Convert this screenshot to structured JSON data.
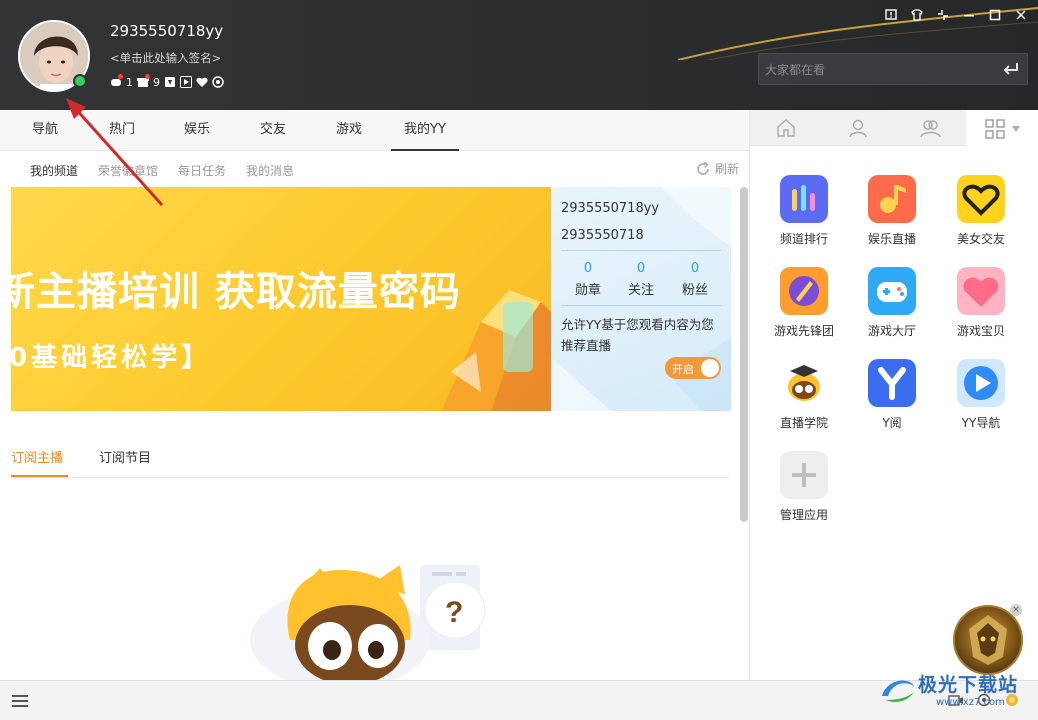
{
  "header": {
    "username": "2935550718yy",
    "signature": "<单击此处输入签名>",
    "status_counts": [
      "1",
      "9"
    ],
    "search_placeholder": "大家都在看"
  },
  "nav": {
    "tabs": [
      "导航",
      "热门",
      "娱乐",
      "交友",
      "游戏",
      "我的YY"
    ],
    "active_tab": "我的YY"
  },
  "subnav": {
    "items": [
      "我的频道",
      "荣誉徽章馆",
      "每日任务",
      "我的消息"
    ],
    "refresh_label": "刷新"
  },
  "banner": {
    "line1": "新主播培训 获取流量密码",
    "line2": "0基础轻松学】"
  },
  "profile_card": {
    "name": "2935550718yy",
    "id": "2935550718",
    "stats": [
      {
        "value": "0",
        "label": "勋章"
      },
      {
        "value": "0",
        "label": "关注"
      },
      {
        "value": "0",
        "label": "粉丝"
      }
    ],
    "note": "允许YY基于您观看内容为您推荐直播",
    "toggle_label": "开启",
    "toggle_on": true
  },
  "subscriptions": {
    "tabs": [
      "订阅主播",
      "订阅节目"
    ],
    "active": "订阅主播"
  },
  "apps": [
    {
      "label": "频道排行",
      "icon": "bar-chart-icon",
      "color": "#5b6cf2"
    },
    {
      "label": "娱乐直播",
      "icon": "music-note-icon",
      "color": "#ff6b4a"
    },
    {
      "label": "美女交友",
      "icon": "heart-icon",
      "color": "#ffd21e"
    },
    {
      "label": "游戏先锋团",
      "icon": "sword-icon",
      "color": "#ff9d2e"
    },
    {
      "label": "游戏大厅",
      "icon": "gamepad-icon",
      "color": "#2fa9f6"
    },
    {
      "label": "游戏宝贝",
      "icon": "pink-heart-icon",
      "color": "#ff7a98"
    },
    {
      "label": "直播学院",
      "icon": "raccoon-graduate-icon",
      "color": "#ffffff"
    },
    {
      "label": "Y阅",
      "icon": "y-logo-icon",
      "color": "#3b6df0"
    },
    {
      "label": "YY导航",
      "icon": "play-arrow-icon",
      "color": "#2f8cf3"
    },
    {
      "label": "管理应用",
      "icon": "plus-icon",
      "color": "#eeeeee"
    }
  ],
  "watermark": {
    "text": "极光下载站",
    "url": "www.xz7.com"
  }
}
